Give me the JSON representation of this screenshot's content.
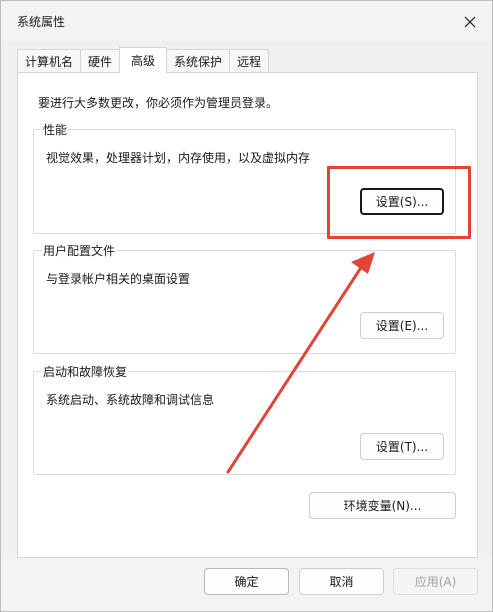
{
  "window": {
    "title": "系统属性",
    "close_icon": "close-icon"
  },
  "tabs": [
    {
      "label": "计算机名",
      "active": false
    },
    {
      "label": "硬件",
      "active": false
    },
    {
      "label": "高级",
      "active": true
    },
    {
      "label": "系统保护",
      "active": false
    },
    {
      "label": "远程",
      "active": false
    }
  ],
  "advanced": {
    "admin_note": "要进行大多数更改，你必须作为管理员登录。",
    "performance": {
      "title": "性能",
      "description": "视觉效果，处理器计划，内存使用，以及虚拟内存",
      "button": "设置(S)..."
    },
    "user_profiles": {
      "title": "用户配置文件",
      "description": "与登录帐户相关的桌面设置",
      "button": "设置(E)..."
    },
    "startup_recovery": {
      "title": "启动和故障恢复",
      "description": "系统启动、系统故障和调试信息",
      "button": "设置(T)..."
    },
    "env_vars_button": "环境变量(N)..."
  },
  "footer": {
    "ok": "确定",
    "cancel": "取消",
    "apply": "应用(A)"
  },
  "annotation": {
    "highlight_color": "#e04535"
  }
}
